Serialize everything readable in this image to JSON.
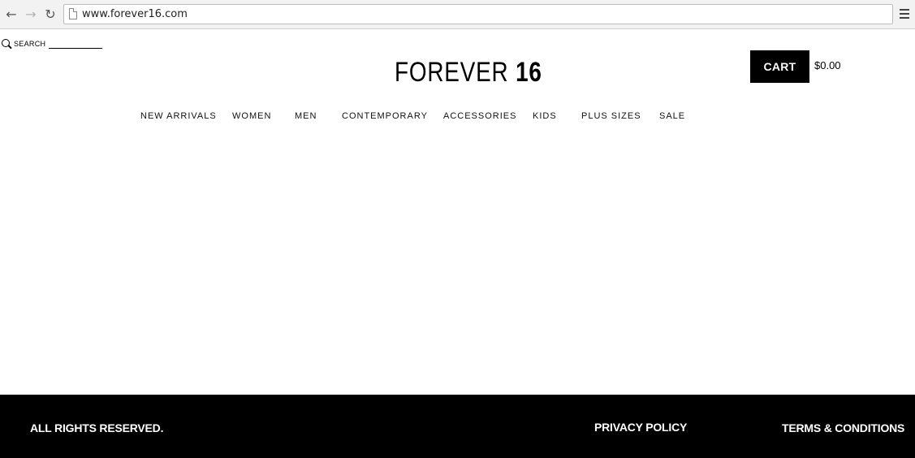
{
  "browser": {
    "url": "www.forever16.com"
  },
  "header": {
    "search_label": "SEARCH",
    "search_value": "",
    "logo_text": "FOREVER",
    "logo_number": "16",
    "cart_label": "CART",
    "cart_total": "$0.00"
  },
  "nav": {
    "items": [
      {
        "label": "NEW ARRIVALS"
      },
      {
        "label": "WOMEN"
      },
      {
        "label": "MEN"
      },
      {
        "label": "CONTEMPORARY"
      },
      {
        "label": "ACCESSORIES"
      },
      {
        "label": "KIDS"
      },
      {
        "label": "PLUS SIZES"
      },
      {
        "label": "SALE"
      }
    ]
  },
  "footer": {
    "rights": "ALL RIGHTS RESERVED.",
    "privacy": "PRIVACY POLICY",
    "terms": "TERMS & CONDITIONS"
  },
  "icons": {
    "back": "arrow-left-icon",
    "forward": "arrow-right-icon",
    "reload": "reload-icon",
    "page": "page-icon",
    "menu": "hamburger-menu-icon",
    "search": "search-icon"
  },
  "colors": {
    "footer_bg": "#000000",
    "cart_bg": "#000000",
    "page_bg": "#ffffff"
  }
}
